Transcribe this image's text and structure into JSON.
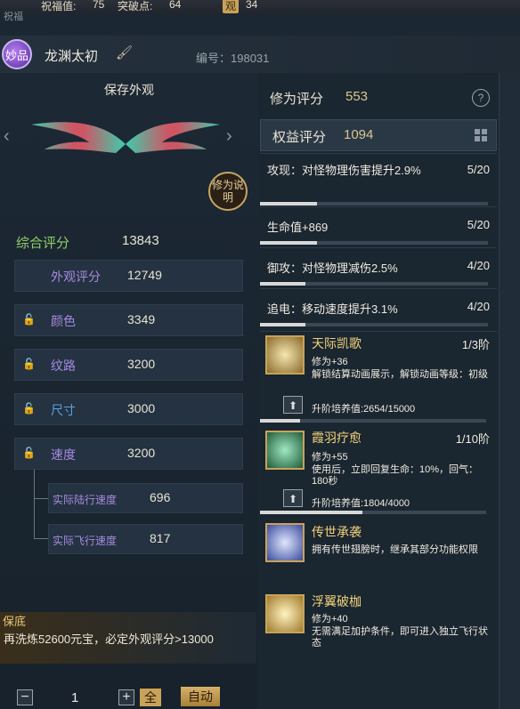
{
  "top": {
    "blessing_label": "祝福值:",
    "blessing_value": "75",
    "breakthrough_label": "突破点:",
    "breakthrough_value": "64",
    "guan_badge": "观",
    "guan_value": "34",
    "corner_label": "祝福"
  },
  "header": {
    "quality_badge": "妙品",
    "item_name": "龙渊太初",
    "id_text": "编号：198031"
  },
  "left": {
    "save_title": "保存外观",
    "explain_button": "修为说明",
    "total_label": "综合评分",
    "total_value": "13843",
    "appearance_label": "外观评分",
    "appearance_value": "12749",
    "stats": [
      {
        "label": "颜色",
        "value": "3349"
      },
      {
        "label": "纹路",
        "value": "3200"
      },
      {
        "label": "尺寸",
        "value": "3000"
      },
      {
        "label": "速度",
        "value": "3200"
      }
    ],
    "sub_stats": [
      {
        "label": "实际陆行速度",
        "value": "696"
      },
      {
        "label": "实际飞行速度",
        "value": "817"
      }
    ],
    "guarantee_title": "保底",
    "guarantee_text": "再洗炼52600元宝，必定外观评分>13000",
    "quantity": "1",
    "minus": "−",
    "plus": "+",
    "all_button": "全",
    "auto_button": "自动"
  },
  "right": {
    "cultivation_label": "修为评分",
    "cultivation_value": "553",
    "help": "?",
    "benefit_label": "权益评分",
    "benefit_value": "1094",
    "stat_rows": [
      {
        "text": "攻现：对怪物理伤害提升2.9%",
        "count": "5/20",
        "progress": 0.25
      },
      {
        "text": "生命值+869",
        "count": "5/20",
        "progress": 0.25
      },
      {
        "text": "御攻：对怪物理减伤2.5%",
        "count": "4/20",
        "progress": 0.2
      },
      {
        "text": "追电：移动速度提升3.1%",
        "count": "4/20",
        "progress": 0.2
      }
    ],
    "skills": [
      {
        "name": "天际凯歌",
        "level": "1/3阶",
        "desc1": "修为+36",
        "desc2": "解锁结算动画展示，解锁动画等级：初级",
        "upgrade": "升阶培养值:2654/15000",
        "progress": 0.177
      },
      {
        "name": "霞羽疗愈",
        "level": "1/10阶",
        "desc1": "修为+55",
        "desc2": "使用后，立即回复生命：10%，回气：180秒",
        "upgrade": "升阶培养值:1804/4000",
        "progress": 0.451
      },
      {
        "name": "传世承袭",
        "desc2": "拥有传世翅膀时，继承其部分功能权限"
      },
      {
        "name": "浮翼破枷",
        "desc1": "修为+40",
        "desc2": "无需满足加护条件，即可进入独立飞行状态"
      }
    ]
  },
  "icons": [
    "lock-icon",
    "brush-icon",
    "grid-icon",
    "arrow-up-icon",
    "question-icon"
  ]
}
